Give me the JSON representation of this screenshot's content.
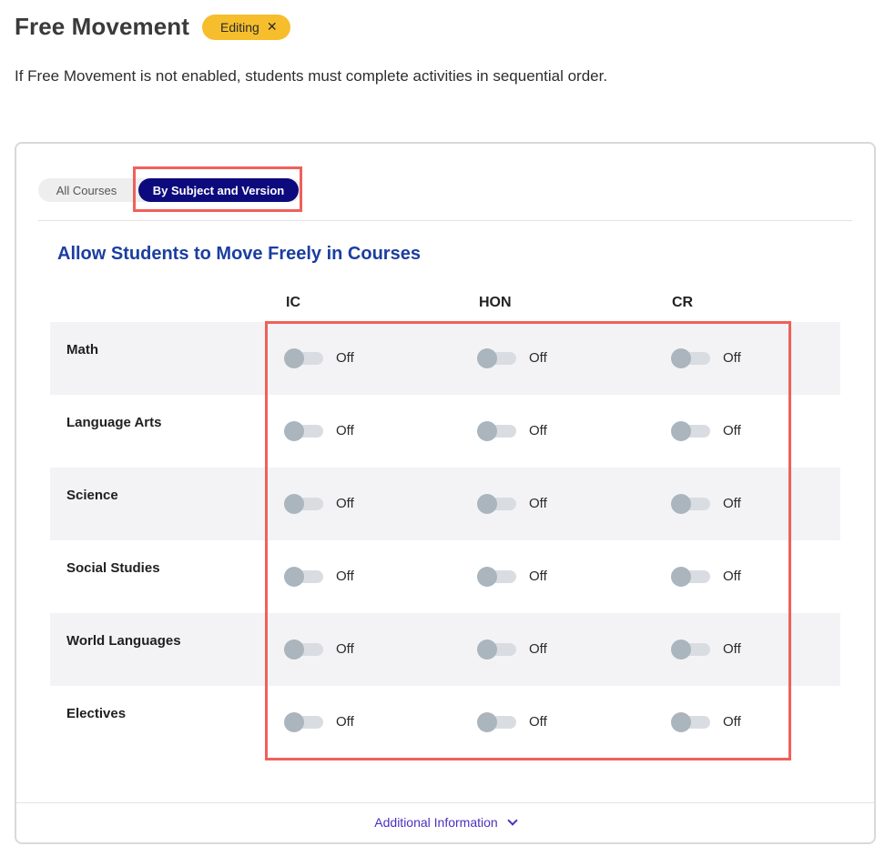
{
  "header": {
    "title": "Free Movement",
    "badge_label": "Editing",
    "badge_close": "✕"
  },
  "subtitle": "If Free Movement is not enabled, students must complete activities in sequential order.",
  "tabs": {
    "all_courses": "All Courses",
    "by_subject": "By Subject and Version",
    "active": "by_subject"
  },
  "section_title": "Allow Students to Move Freely in Courses",
  "columns": [
    "IC",
    "HON",
    "CR"
  ],
  "rows": [
    {
      "subject": "Math",
      "toggles": [
        "Off",
        "Off",
        "Off"
      ]
    },
    {
      "subject": "Language Arts",
      "toggles": [
        "Off",
        "Off",
        "Off"
      ]
    },
    {
      "subject": "Science",
      "toggles": [
        "Off",
        "Off",
        "Off"
      ]
    },
    {
      "subject": "Social Studies",
      "toggles": [
        "Off",
        "Off",
        "Off"
      ]
    },
    {
      "subject": "World Languages",
      "toggles": [
        "Off",
        "Off",
        "Off"
      ]
    },
    {
      "subject": "Electives",
      "toggles": [
        "Off",
        "Off",
        "Off"
      ]
    }
  ],
  "footer": {
    "additional_info": "Additional Information",
    "icon": "chevron-down-icon"
  },
  "colors": {
    "badge": "#f6be2c",
    "active_tab": "#0d0a7e",
    "section_title": "#1b3ea0",
    "highlight": "#f0605a",
    "link": "#4c2fbf"
  }
}
